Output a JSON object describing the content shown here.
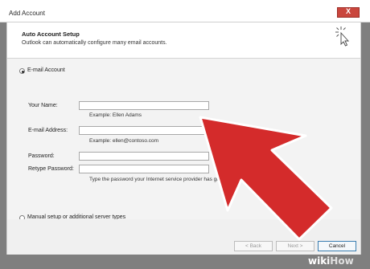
{
  "window": {
    "title": "Add Account",
    "close_glyph": "X"
  },
  "header": {
    "title": "Auto Account Setup",
    "subtitle": "Outlook can automatically configure many email accounts.",
    "icon": "cursor-click-icon"
  },
  "options": {
    "email_account": "E-mail Account",
    "manual_setup": "Manual setup or additional server types"
  },
  "form": {
    "your_name_label": "Your Name:",
    "your_name_value": "",
    "your_name_hint": "Example: Ellen Adams",
    "email_label": "E-mail Address:",
    "email_value": "",
    "email_hint": "Example: ellen@contoso.com",
    "password_label": "Password:",
    "password_value": "",
    "retype_label": "Retype Password:",
    "retype_value": "",
    "password_hint": "Type the password your Internet service provider has giv"
  },
  "buttons": {
    "back": "< Back",
    "next": "Next >",
    "cancel": "Cancel"
  },
  "watermark": {
    "wiki": "wiki",
    "how": "How"
  },
  "colors": {
    "arrow": "#d42b2b",
    "close": "#c9463d"
  }
}
